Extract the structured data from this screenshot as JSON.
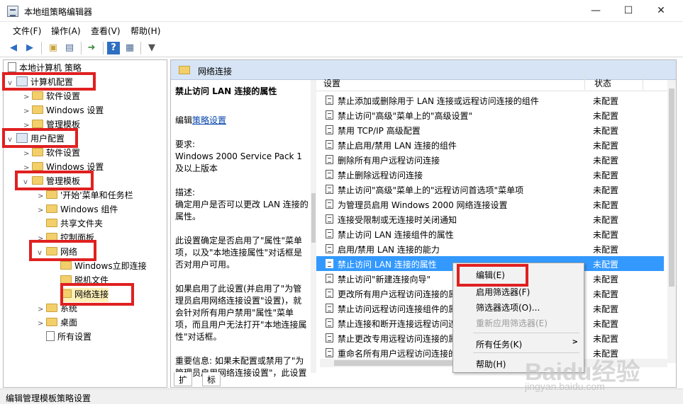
{
  "window": {
    "title": "本地组策略编辑器",
    "min": "—",
    "max": "☐",
    "close": "✕"
  },
  "menu": [
    "文件(F)",
    "操作(A)",
    "查看(V)",
    "帮助(H)"
  ],
  "toolbar_icons": [
    "back-arrow-icon",
    "forward-arrow-icon",
    "up-folder-icon",
    "show-tree-icon",
    "export-icon",
    "help-icon",
    "properties-icon",
    "filter-icon"
  ],
  "tree": {
    "root": "本地计算机 策略",
    "computer_config": "计算机配置",
    "software_settings_1": "软件设置",
    "windows_settings_1": "Windows 设置",
    "admin_templates_1": "管理模板",
    "user_config": "用户配置",
    "software_settings_2": "软件设置",
    "windows_settings_2": "Windows 设置",
    "admin_templates_2": "管理模板",
    "start_menu": "'开始'菜单和任务栏",
    "windows_components": "Windows 组件",
    "shared_folders": "共享文件夹",
    "control_panel": "控制面板",
    "network": "网络",
    "windows_instant_connect": "Windows立即连接",
    "offline_files": "脱机文件",
    "network_connections": "网络连接",
    "system": "系统",
    "desktop": "桌面",
    "all_settings": "所有设置"
  },
  "detail": {
    "header": "网络连接",
    "desc_title": "禁止访问 LAN 连接的属性",
    "edit_prefix": "编辑",
    "edit_link": "策略设置",
    "req_label": "要求:",
    "req_text": "Windows 2000 Service Pack 1 及以上版本",
    "desc_label": "描述:",
    "desc_text": "确定用户是否可以更改 LAN 连接的属性。",
    "para1": "此设置确定是否启用了\"属性\"菜单项，以及\"本地连接属性\"对话框是否对用户可用。",
    "para2": "如果启用了此设置(并启用了\"为管理员启用网络连接设置\"设置)，就会针对所有用户禁用\"属性\"菜单项，而且用户无法打开\"本地连接属性\"对话框。",
    "para3": "重要信息: 如果未配置或禁用了\"为管理员启用网络连接设置\"，此设置"
  },
  "list": {
    "col_setting": "设置",
    "col_state": "状态",
    "rows": [
      {
        "name": "禁止添加或删除用于 LAN 连接或远程访问连接的组件",
        "state": "未配置"
      },
      {
        "name": "禁止访问\"高级\"菜单上的\"高级设置\"",
        "state": "未配置"
      },
      {
        "name": "禁用 TCP/IP 高级配置",
        "state": "未配置"
      },
      {
        "name": "禁止启用/禁用 LAN 连接的组件",
        "state": "未配置"
      },
      {
        "name": "删除所有用户远程访问连接",
        "state": "未配置"
      },
      {
        "name": "禁止删除远程访问连接",
        "state": "未配置"
      },
      {
        "name": "禁止访问\"高级\"菜单上的\"远程访问首选项\"菜单项",
        "state": "未配置"
      },
      {
        "name": "为管理员启用 Windows 2000 网络连接设置",
        "state": "未配置"
      },
      {
        "name": "连接受限制或无连接时关闭通知",
        "state": "未配置"
      },
      {
        "name": "禁止访问 LAN 连接组件的属性",
        "state": "未配置"
      },
      {
        "name": "启用/禁用 LAN 连接的能力",
        "state": "未配置"
      },
      {
        "name": "禁止访问 LAN 连接的属性",
        "state": "未配置"
      },
      {
        "name": "禁止访问\"新建连接向导\"",
        "state": "未配置"
      },
      {
        "name": "更改所有用户远程访问连接的属",
        "state": "未配置"
      },
      {
        "name": "禁止访问远程访问连接组件的属",
        "state": "未配置"
      },
      {
        "name": "禁止连接和断开连接远程访问连",
        "state": "未配置"
      },
      {
        "name": "禁止更改专用远程访问连接的属",
        "state": "未配置"
      },
      {
        "name": "重命名所有用户远程访问连接的",
        "state": "未配置"
      }
    ]
  },
  "tabs": [
    "扩展",
    "标准"
  ],
  "context_menu": {
    "edit": "编辑(E)",
    "enable_filter": "启用筛选器(F)",
    "filter_options": "筛选器选项(O)...",
    "reapply_filter": "重新应用筛选器(E)",
    "all_tasks": "所有任务(K)",
    "help": "帮助(H)"
  },
  "status": "编辑管理模板策略设置",
  "watermark": {
    "logo": "Baidu经验",
    "url": "jingyan.baidu.com"
  },
  "colors": {
    "highlight": "#e02020",
    "selection": "#3399ff",
    "header": "#d6e4f5"
  }
}
